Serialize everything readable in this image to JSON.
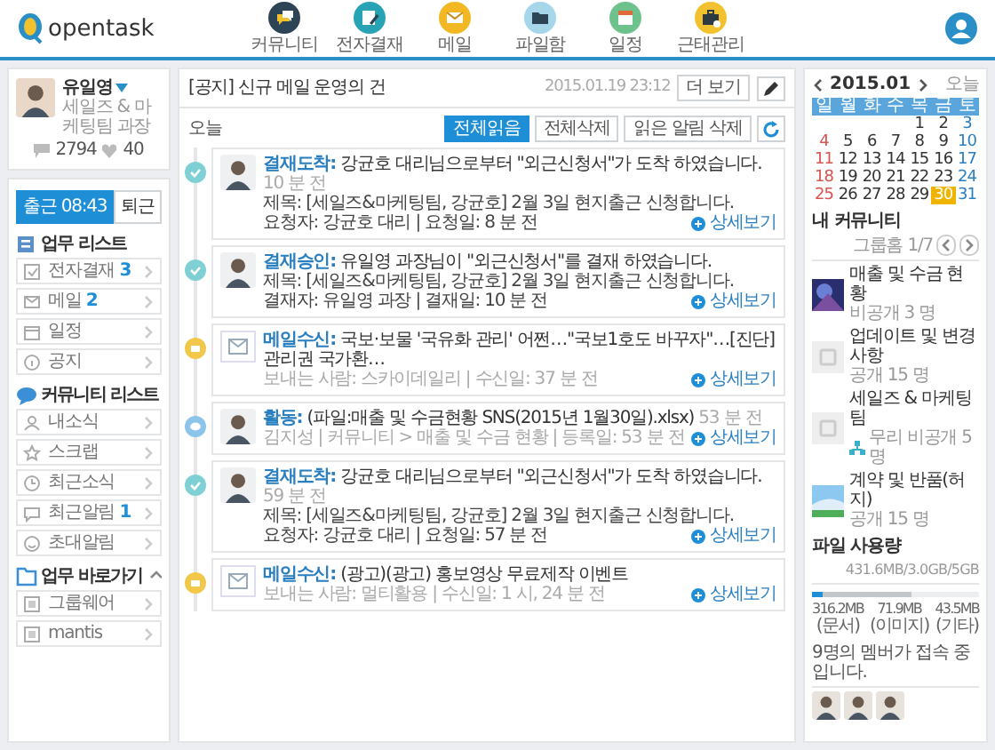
{
  "header": {
    "logo": "opentask",
    "nav": [
      {
        "label": "커뮤니티",
        "kind": "chat"
      },
      {
        "label": "전자결재",
        "kind": "approval"
      },
      {
        "label": "메일",
        "kind": "mail"
      },
      {
        "label": "파일함",
        "kind": "files"
      },
      {
        "label": "일정",
        "kind": "schedule"
      },
      {
        "label": "근태관리",
        "kind": "attendance"
      }
    ]
  },
  "profile": {
    "name": "유일영",
    "title": "세일즈 & 마케팅팀 과장",
    "comments": "2794",
    "likes": "40"
  },
  "attendance": [
    {
      "label": "출근 08:43",
      "selected": true
    },
    {
      "label": "퇴근",
      "selected": false
    }
  ],
  "sections": [
    {
      "title": "업무 리스트",
      "kind": "work",
      "items": [
        {
          "label": "전자결재",
          "count": "3",
          "kind": "approval"
        },
        {
          "label": "메일",
          "count": "2",
          "kind": "mail"
        },
        {
          "label": "일정",
          "kind": "schedule"
        },
        {
          "label": "공지",
          "kind": "notice"
        }
      ]
    },
    {
      "title": "커뮤니티 리스트",
      "kind": "community",
      "items": [
        {
          "label": "내소식",
          "kind": "news"
        },
        {
          "label": "스크랩",
          "kind": "scrap"
        },
        {
          "label": "최근소식",
          "kind": "recent"
        },
        {
          "label": "최근알림",
          "count": "1",
          "kind": "alert"
        },
        {
          "label": "초대알림",
          "kind": "invite"
        }
      ]
    },
    {
      "title": "업무 바로가기",
      "kind": "shortcut",
      "expanded": true,
      "items": [
        {
          "label": "그룹웨어",
          "kind": "link"
        },
        {
          "label": "mantis",
          "kind": "link"
        }
      ]
    }
  ],
  "notice": {
    "title": "[공지] 신규 메일 운영의 건",
    "date": "2015.01.19 23:12",
    "more": "더 보기"
  },
  "today": "오늘",
  "actions": [
    {
      "label": "전체읽음",
      "selected": true
    },
    {
      "label": "전체삭제",
      "selected": false
    },
    {
      "label": "읽은 알림 삭제",
      "selected": false
    }
  ],
  "feed": [
    {
      "kind": "approval",
      "label": "결재도착:",
      "text": "강균호 대리님으로부터 \"외근신청서\"가 도착 하였습니다.",
      "time": "10 분 전",
      "lines": [
        "제목: [세일즈&마케팅팀, 강균호] 2월 3일 현지출근 신청합니다.",
        "요청자: 강균호 대리 | 요청일: 8 분 전"
      ],
      "link": "상세보기"
    },
    {
      "kind": "approval",
      "label": "결재승인:",
      "text": "유일영 과장님이 \"외근신청서\"를 결재 하였습니다.",
      "lines": [
        "제목: [세일즈&마케팅팀, 강균호] 2월 3일 현지출근 신청합니다.",
        "결재자: 유일영 과장 | 결재일: 10 분 전"
      ],
      "link": "상세보기"
    },
    {
      "kind": "mail",
      "label": "메일수신:",
      "text": "국보·보물 '국유화 관리' 어쩐…\"국보1호도 바꾸자\"…[진단]관리권 국가환…",
      "lines": [
        "보내는 사람: 스카이데일리 | 수신일: 37 분 전"
      ],
      "link": "상세보기"
    },
    {
      "kind": "activity",
      "label": "활동:",
      "text": "(파일:매출 및 수금현황 SNS(2015년 1월30일).xlsx)",
      "time": "53 분 전",
      "lines": [
        "김지성 | 커뮤니티 > 매출 및 수금 현황 | 등록일: 53 분 전"
      ],
      "link": "상세보기"
    },
    {
      "kind": "approval",
      "label": "결재도착:",
      "text": "강균호 대리님으로부터 \"외근신청서\"가 도착 하였습니다.",
      "time": "59 분 전",
      "lines": [
        "제목: [세일즈&마케팅팀, 강균호] 2월 3일 현지출근 신청합니다.",
        "요청자: 강균호 대리 | 요청일: 57 분 전"
      ],
      "link": "상세보기"
    },
    {
      "kind": "mail",
      "label": "메일수신:",
      "text": "(광고)(광고) 홍보영상 무료제작 이벤트",
      "lines": [
        "보내는 사람: 멀티활용 | 수신일: 1 시, 24 분 전"
      ],
      "link": "상세보기"
    }
  ],
  "calendar": {
    "month": "2015.01",
    "today": "오늘",
    "weekdays": [
      "일",
      "월",
      "화",
      "수",
      "목",
      "금",
      "토"
    ],
    "weeks": [
      [
        {
          "day": "1",
          "selected": false
        },
        {
          "day": "2",
          "selected": false
        },
        {
          "day": "3",
          "selected": false
        }
      ],
      [
        {
          "day": "4",
          "selected": false
        },
        {
          "day": "5",
          "selected": false
        },
        {
          "day": "6",
          "selected": false
        },
        {
          "day": "7",
          "selected": false
        },
        {
          "day": "8",
          "selected": false
        },
        {
          "day": "9",
          "selected": false
        },
        {
          "day": "10",
          "selected": false
        }
      ],
      [
        {
          "day": "11",
          "selected": false
        },
        {
          "day": "12",
          "selected": false
        },
        {
          "day": "13",
          "selected": false
        },
        {
          "day": "14",
          "selected": false
        },
        {
          "day": "15",
          "selected": false
        },
        {
          "day": "16",
          "selected": false
        },
        {
          "day": "17",
          "selected": false
        }
      ],
      [
        {
          "day": "18",
          "selected": false
        },
        {
          "day": "19",
          "selected": false
        },
        {
          "day": "20",
          "selected": false
        },
        {
          "day": "21",
          "selected": false
        },
        {
          "day": "22",
          "selected": false
        },
        {
          "day": "23",
          "selected": false
        },
        {
          "day": "24",
          "selected": false
        }
      ],
      [
        {
          "day": "25",
          "selected": false
        },
        {
          "day": "26",
          "selected": false
        },
        {
          "day": "27",
          "selected": false
        },
        {
          "day": "28",
          "selected": false
        },
        {
          "day": "29",
          "selected": false
        },
        {
          "day": "30",
          "selected": true
        },
        {
          "day": "31",
          "selected": false
        }
      ]
    ]
  },
  "community": {
    "title": "내 커뮤니티",
    "pager": "그룹홈 1/7",
    "items": [
      {
        "name": "매출 및 수금 현황",
        "meta": "비공개 3 명",
        "kind": "picture",
        "group": false
      },
      {
        "name": "업데이트 및 변경사항",
        "meta": "공개 15 명",
        "kind": "blank",
        "group": false
      },
      {
        "name": "세일즈 & 마케팅팀",
        "meta": "무리 비공개 5 명",
        "kind": "blank",
        "group": true
      },
      {
        "name": "계약 및 반품(허지)",
        "meta": "공개 15 명",
        "kind": "picture",
        "group": false
      }
    ]
  },
  "usage": {
    "title": "파일 사용량",
    "total": "431.6MB/3.0GB/5GB",
    "segments": [
      {
        "value": "316.2MB",
        "label": "(문서)",
        "level": 0.06
      },
      {
        "value": "71.9MB",
        "label": "(이미지)",
        "level": 0.54
      },
      {
        "value": "43.5MB",
        "label": "(기타)"
      }
    ]
  },
  "online": {
    "text": "9명의 멤버가 접속 중입니다.",
    "members": [
      {
        "kind": "avatar"
      },
      {
        "kind": "avatar"
      },
      {
        "kind": "avatar"
      }
    ]
  }
}
